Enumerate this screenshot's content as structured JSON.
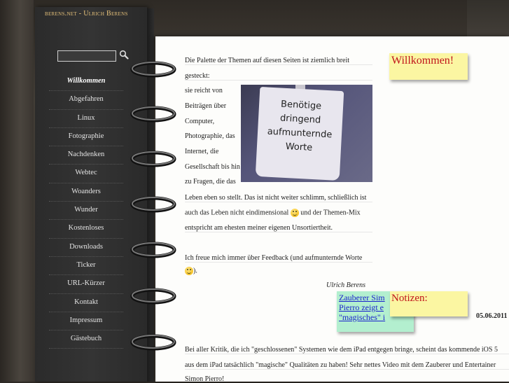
{
  "site": {
    "title_prefix": "berens.net - ",
    "title_name": "Ulrich Berens"
  },
  "search": {
    "value": "",
    "placeholder": ""
  },
  "nav": [
    {
      "label": "Willkommen",
      "active": true
    },
    {
      "label": "Abgefahren"
    },
    {
      "label": "Linux"
    },
    {
      "label": "Fotographie"
    },
    {
      "label": "Nachdenken"
    },
    {
      "label": "Webtec"
    },
    {
      "label": "Woanders"
    },
    {
      "label": "Wunder"
    },
    {
      "label": "Kostenloses"
    },
    {
      "label": "Downloads"
    },
    {
      "label": "Ticker"
    },
    {
      "label": "URL-Kürzer"
    },
    {
      "label": "Kontakt"
    },
    {
      "label": "Impressum"
    },
    {
      "label": "Gästebuch"
    }
  ],
  "welcome": {
    "line1": "Die Palette der Themen auf diesen Seiten ist ziemlich breit",
    "line2": "gesteckt:",
    "left_lines": [
      "sie reicht von",
      "Beiträgen über",
      "Computer,",
      "Photographie, das",
      "Internet, die",
      "Gesellschaft bis hin",
      "zu Fragen, die das"
    ],
    "line_full1": "Leben eben so stellt. Das ist nicht weiter schlimm, schließlich ist",
    "line_full2a": "auch das Leben nicht eindimensional",
    "line_full2b": "und der Themen-Mix",
    "line_full3": "entspricht am ehesten meiner eigenen Unsortiertheit.",
    "feedback": "Ich freue mich immer über Feedback (und aufmunternde Worte",
    "feedback_end": ").",
    "signature": "Ulrich Berens"
  },
  "photo_sign": [
    "Benötige",
    "dringend",
    "aufmunternde",
    "Worte"
  ],
  "notes": {
    "welcome_title": "Willkommen!",
    "notes_title": "Notizen:",
    "green_lines": [
      "Zauberer Sim",
      "Pierro zeigt e",
      "\"magisches\" i"
    ]
  },
  "news": {
    "date": "05.06.2011",
    "line1": "Bei aller Kritik, die ich \"geschlossenen\" Systemen wie dem iPad entgegen bringe, scheint das kommende iOS 5",
    "line2": "aus dem iPad tatsächlich \"magische\" Qualitäten zu haben! Sehr nettes Video mit dem Zauberer und Entertainer",
    "line3": "Simon Pierro!"
  },
  "icons": {
    "search": "magnifier-icon",
    "rings": "binder-ring-icon",
    "smiley": "smiley-icon"
  },
  "colors": {
    "title": "#e7c27a",
    "note_yellow": "#fbf6a2",
    "note_green": "#b3efcf",
    "note_text": "#c0141a"
  }
}
